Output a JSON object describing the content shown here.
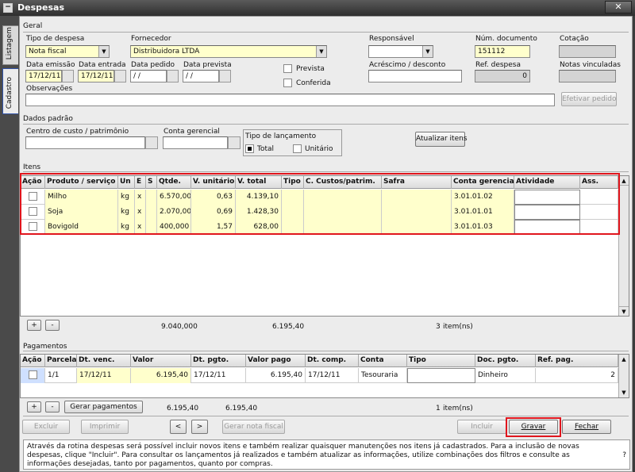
{
  "window": {
    "title": "Despesas",
    "icon": "minus-icon",
    "close": "✕"
  },
  "tabs": [
    "Listagem",
    "Cadastro"
  ],
  "geral": {
    "section": "Geral",
    "tipo_despesa": {
      "label": "Tipo de despesa",
      "value": "Nota fiscal"
    },
    "fornecedor": {
      "label": "Fornecedor",
      "value": "Distribuidora LTDA"
    },
    "responsavel": {
      "label": "Responsável",
      "value": ""
    },
    "num_documento": {
      "label": "Núm. documento",
      "value": "151112"
    },
    "cotacao": {
      "label": "Cotação",
      "value": ""
    },
    "data_emissao": {
      "label": "Data emissão",
      "value": "17/12/11"
    },
    "data_entrada": {
      "label": "Data entrada",
      "value": "17/12/11"
    },
    "data_pedido": {
      "label": "Data pedido",
      "value": " / /"
    },
    "data_prevista": {
      "label": "Data prevista",
      "value": " / /"
    },
    "prevista": "Prevista",
    "conferida": "Conferida",
    "acrescimo": {
      "label": "Acréscimo / desconto",
      "value": ""
    },
    "ref_despesa": {
      "label": "Ref. despesa",
      "value": "0"
    },
    "notas_vinculadas": {
      "label": "Notas vinculadas",
      "value": ""
    },
    "observacoes": {
      "label": "Observações",
      "value": ""
    },
    "efetivar": "Efetivar pedido"
  },
  "dados_padrao": {
    "section": "Dados padrão",
    "centro_custo": "Centro de custo / patrimônio",
    "conta_gerencial": "Conta gerencial",
    "tipo_lancamento": "Tipo de lançamento",
    "total": "Total",
    "unitario": "Unitário",
    "atualizar": "Atualizar itens"
  },
  "itens": {
    "section": "Itens",
    "columns": [
      "Ação",
      "Produto / serviço",
      "Un",
      "E",
      "S",
      "Qtde.",
      "V. unitário",
      "V. total",
      "Tipo",
      "C. Custos/patrim.",
      "Safra",
      "Conta gerencial",
      "Atividade",
      "Ass."
    ],
    "rows": [
      {
        "produto": "Milho",
        "un": "kg",
        "e": "x",
        "s": "",
        "qtde": "6.570,000",
        "vunit": "0,63",
        "vtotal": "4.139,10",
        "tipo": "",
        "ccusto": "",
        "safra": "",
        "conta": "3.01.01.02",
        "atividade": "",
        "ass": ""
      },
      {
        "produto": "Soja",
        "un": "kg",
        "e": "x",
        "s": "",
        "qtde": "2.070,000",
        "vunit": "0,69",
        "vtotal": "1.428,30",
        "tipo": "",
        "ccusto": "",
        "safra": "",
        "conta": "3.01.01.01",
        "atividade": "",
        "ass": ""
      },
      {
        "produto": "Bovigold",
        "un": "kg",
        "e": "x",
        "s": "",
        "qtde": "400,000",
        "vunit": "1,57",
        "vtotal": "628,00",
        "tipo": "",
        "ccusto": "",
        "safra": "",
        "conta": "3.01.01.03",
        "atividade": "",
        "ass": ""
      }
    ],
    "add": "+",
    "remove": "-",
    "total_qtde": "9.040,000",
    "total_valor": "6.195,40",
    "count": "3",
    "count_label": "item(ns)"
  },
  "pagamentos": {
    "section": "Pagamentos",
    "columns": [
      "Ação",
      "Parcela",
      "Dt. venc.",
      "Valor",
      "Dt. pgto.",
      "Valor pago",
      "Dt. comp.",
      "Conta",
      "Tipo",
      "Doc. pgto.",
      "Ref. pag."
    ],
    "rows": [
      {
        "parcela": "1/1",
        "dtvenc": "17/12/11",
        "valor": "6.195,40",
        "dtpgto": "17/12/11",
        "valorpago": "6.195,40",
        "dtcomp": "17/12/11",
        "conta": "Tesouraria",
        "tipo": "",
        "doc": "Dinheiro",
        "ref": "2"
      }
    ],
    "add": "+",
    "remove": "-",
    "gerar": "Gerar pagamentos",
    "total_valor": "6.195,40",
    "total_pago": "6.195,40",
    "count": "1",
    "count_label": "item(ns)"
  },
  "footer": {
    "excluir": "Excluir",
    "imprimir": "Imprimir",
    "prev": "<",
    "next": ">",
    "gerar_nota": "Gerar nota fiscal",
    "incluir": "Incluir",
    "gravar": "Gravar",
    "fechar": "Fechar"
  },
  "help": {
    "text": "Através da rotina despesas será possível incluir novos itens e também realizar quaisquer manutenções nos itens já cadastrados. Para a inclusão de novas despesas, clique \"Incluir\". Para consultar os lançamentos já realizados e também atualizar as informações, utilize combinações dos filtros e consulte as informações desejadas, tanto por pagamentos, quanto por compras.",
    "q": "?"
  },
  "colors": {
    "highlight": "#e0151d",
    "field_yellow": "#ffffcc",
    "titlebar": "#3a3a3a"
  }
}
